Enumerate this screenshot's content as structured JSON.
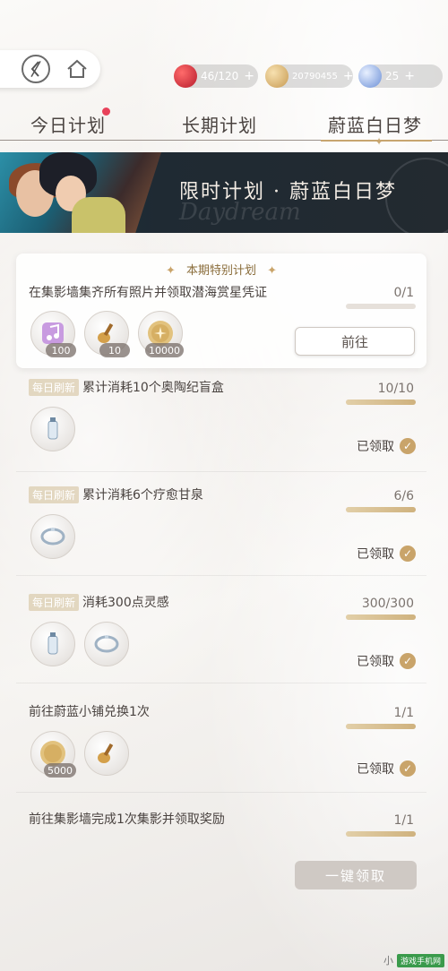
{
  "resources": {
    "stamina": "46/120",
    "coins": "20790455",
    "diamonds": "25",
    "plus": "+"
  },
  "tabs": [
    "今日计划",
    "长期计划",
    "蔚蓝白日梦"
  ],
  "banner": {
    "title": "限时计划 · 蔚蓝白日梦",
    "script": "Daydream"
  },
  "special": {
    "heading": "本期特别计划",
    "deco": "✦",
    "task": "在集影墙集齐所有照片并领取潜海赏星凭证",
    "count": "0/1",
    "progress": 0,
    "rewards": [
      {
        "icon": "music-note-icon",
        "qty": "100"
      },
      {
        "icon": "guitar-icon",
        "qty": "10"
      },
      {
        "icon": "gold-coin-icon",
        "qty": "10000"
      }
    ],
    "goto_label": "前往"
  },
  "tasks": [
    {
      "tag": "每日刷新",
      "text": "累计消耗10个奥陶纪盲盒",
      "count": "10/10",
      "progress": 1,
      "status": "已领取",
      "rewards": [
        "water-bottle-icon"
      ]
    },
    {
      "tag": "每日刷新",
      "text": "累计消耗6个疗愈甘泉",
      "count": "6/6",
      "progress": 1,
      "status": "已领取",
      "rewards": [
        "bracelet-icon"
      ]
    },
    {
      "tag": "每日刷新",
      "text": "消耗300点灵感",
      "count": "300/300",
      "progress": 1,
      "status": "已领取",
      "rewards": [
        "water-bottle-icon",
        "bracelet-icon"
      ]
    },
    {
      "tag": "",
      "text": "前往蔚蓝小铺兑换1次",
      "count": "1/1",
      "progress": 1,
      "status": "已领取",
      "rewards": [
        "gold-coin-icon",
        "guitar-icon"
      ],
      "reward_qty": "5000"
    },
    {
      "tag": "",
      "text": "前往集影墙完成1次集影并领取奖励",
      "count": "1/1",
      "progress": 1,
      "status": "",
      "rewards": []
    }
  ],
  "claim_all_label": "一键领取",
  "watermark": {
    "text": "小",
    "logo": "游戏手机网"
  }
}
